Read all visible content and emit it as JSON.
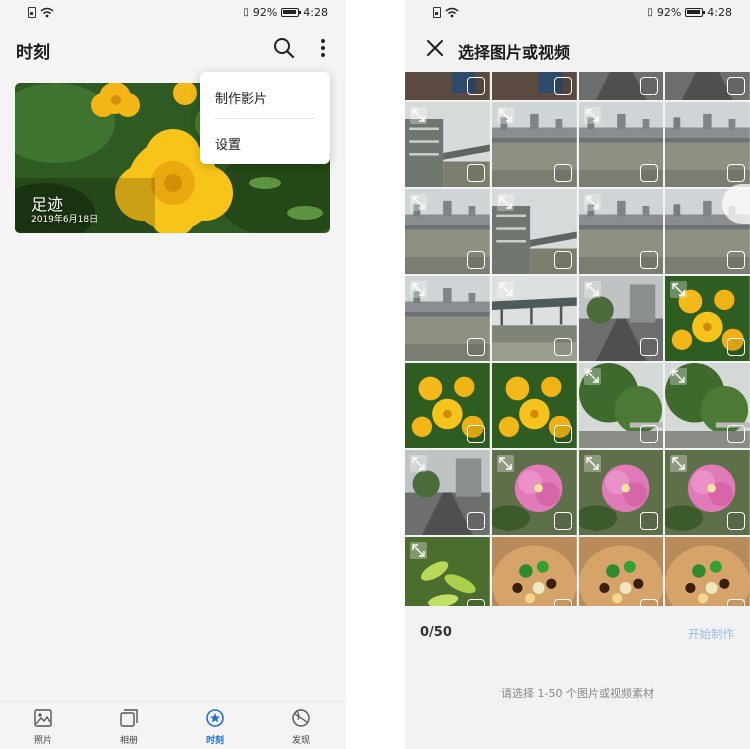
{
  "status": {
    "battery": "92%",
    "time": "4:28"
  },
  "left": {
    "title": "时刻",
    "card": {
      "title": "足迹",
      "date": "2019年6月18日"
    },
    "menu": {
      "item1": "制作影片",
      "item2": "设置"
    },
    "nav": {
      "photos": "照片",
      "albums": "相册",
      "moments": "时刻",
      "discover": "发现"
    },
    "accent": "#1f6fd6"
  },
  "right": {
    "title": "选择图片或视频",
    "count": "0/50",
    "start": "开始制作",
    "hint": "请选择 1-50 个图片或视频素材",
    "tiles": [
      {
        "type": "people",
        "video": false
      },
      {
        "type": "people",
        "video": false
      },
      {
        "type": "street",
        "video": false
      },
      {
        "type": "street",
        "video": false
      },
      {
        "type": "building",
        "video": true
      },
      {
        "type": "river",
        "video": true
      },
      {
        "type": "river",
        "video": true
      },
      {
        "type": "river",
        "video": false
      },
      {
        "type": "river",
        "video": true
      },
      {
        "type": "building",
        "video": true
      },
      {
        "type": "river",
        "video": true
      },
      {
        "type": "river",
        "video": false
      },
      {
        "type": "river",
        "video": true
      },
      {
        "type": "bridge",
        "video": true
      },
      {
        "type": "street",
        "video": true
      },
      {
        "type": "flower",
        "video": true
      },
      {
        "type": "flower",
        "video": false
      },
      {
        "type": "flower",
        "video": false
      },
      {
        "type": "tree",
        "video": true
      },
      {
        "type": "tree",
        "video": true
      },
      {
        "type": "street",
        "video": true
      },
      {
        "type": "pink",
        "video": true
      },
      {
        "type": "pink",
        "video": true
      },
      {
        "type": "pink",
        "video": true
      },
      {
        "type": "leaf",
        "video": true
      },
      {
        "type": "food",
        "video": false
      },
      {
        "type": "food",
        "video": false
      },
      {
        "type": "food",
        "video": false
      }
    ]
  }
}
